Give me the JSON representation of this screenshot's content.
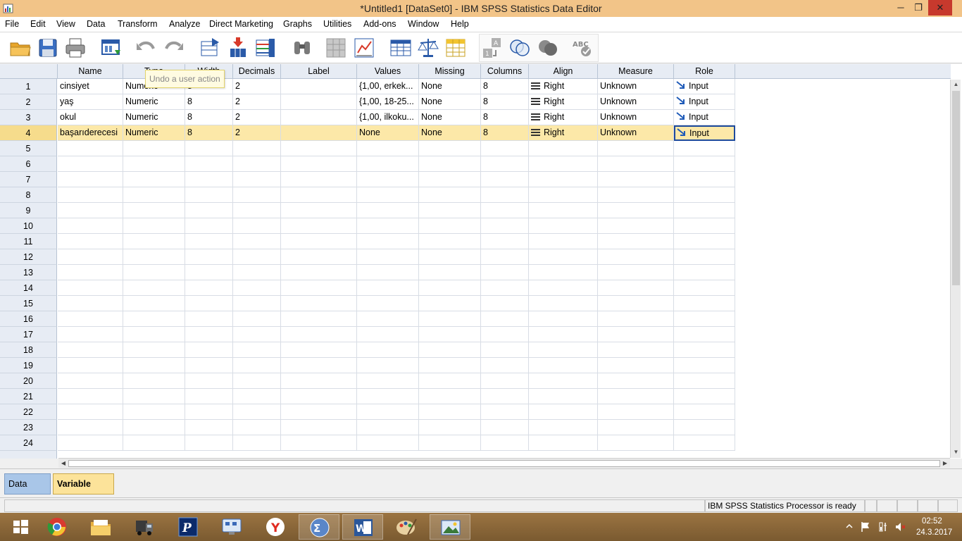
{
  "window": {
    "title": "*Untitled1 [DataSet0] - IBM SPSS Statistics Data Editor",
    "minimize": "─",
    "restore": "❐",
    "close": "✕"
  },
  "menu": [
    "File",
    "Edit",
    "View",
    "Data",
    "Transform",
    "Analyze",
    "Direct Marketing",
    "Graphs",
    "Utilities",
    "Add-ons",
    "Window",
    "Help"
  ],
  "tooltip": "Undo a user action",
  "columns": [
    "Name",
    "Type",
    "Width",
    "Decimals",
    "Label",
    "Values",
    "Missing",
    "Columns",
    "Align",
    "Measure",
    "Role"
  ],
  "rows": [
    {
      "num": "1",
      "name": "cinsiyet",
      "type": "Numeric",
      "width": "8",
      "decimals": "2",
      "label": "",
      "values": "{1,00, erkek...",
      "missing": "None",
      "columns": "8",
      "align": "Right",
      "measure": "Unknown",
      "role": "Input"
    },
    {
      "num": "2",
      "name": "yaş",
      "type": "Numeric",
      "width": "8",
      "decimals": "2",
      "label": "",
      "values": "{1,00, 18-25...",
      "missing": "None",
      "columns": "8",
      "align": "Right",
      "measure": "Unknown",
      "role": "Input"
    },
    {
      "num": "3",
      "name": "okul",
      "type": "Numeric",
      "width": "8",
      "decimals": "2",
      "label": "",
      "values": "{1,00, ilkoku...",
      "missing": "None",
      "columns": "8",
      "align": "Right",
      "measure": "Unknown",
      "role": "Input"
    },
    {
      "num": "4",
      "name": "başarıderecesi",
      "type": "Numeric",
      "width": "8",
      "decimals": "2",
      "label": "",
      "values": "None",
      "missing": "None",
      "columns": "8",
      "align": "Right",
      "measure": "Unknown",
      "role": "Input"
    }
  ],
  "empty_rows": [
    "5",
    "6",
    "7",
    "8",
    "9",
    "10",
    "11",
    "12",
    "13",
    "14",
    "15",
    "16",
    "17",
    "18",
    "19",
    "20",
    "21",
    "22",
    "23",
    "24"
  ],
  "selected_row": "4",
  "tabs": {
    "data_view": "Data View",
    "variable_view": "Variable View",
    "active": "Variable View"
  },
  "status": {
    "processor": "IBM SPSS Statistics Processor is ready"
  },
  "clock": {
    "time": "02:52",
    "date": "24.3.2017"
  },
  "colors": {
    "selected_row": "#fce8a8",
    "active_tab": "#fce39a",
    "data_tab": "#a9c6e8",
    "titlebar": "#f2c488"
  }
}
